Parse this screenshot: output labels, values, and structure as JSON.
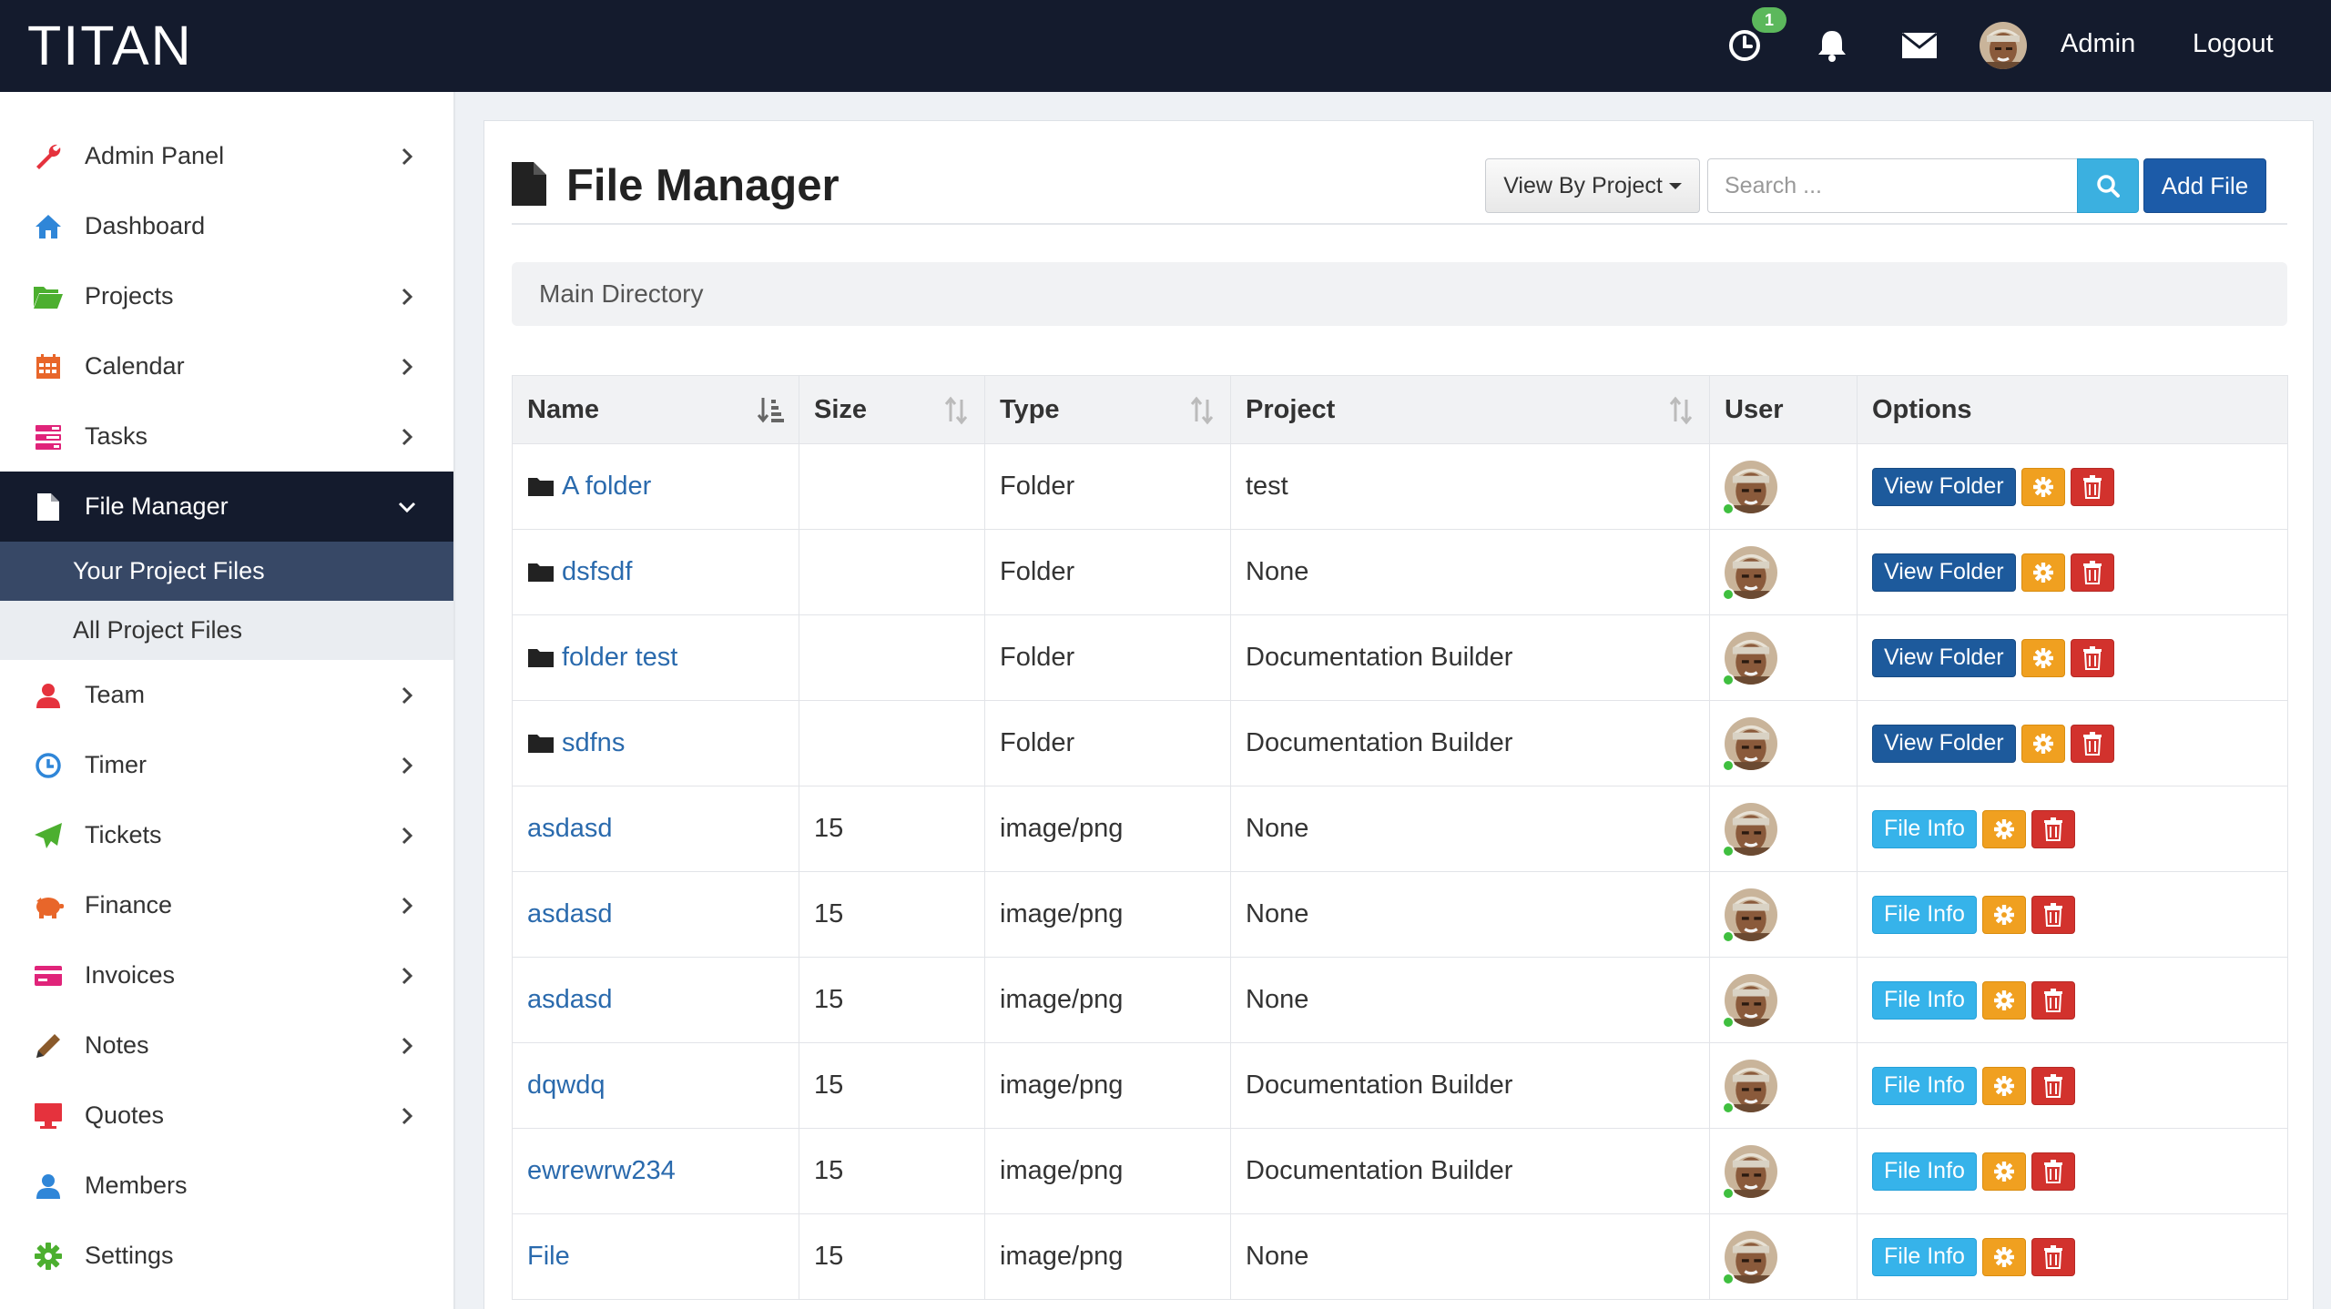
{
  "app": {
    "brand": "TITAN"
  },
  "topbar": {
    "timer_badge": "1",
    "user_name": "Admin",
    "logout_label": "Logout",
    "icons": [
      "clock-icon",
      "bell-icon",
      "envelope-icon",
      "avatar"
    ]
  },
  "sidebar": {
    "items": [
      {
        "label": "Admin Panel",
        "icon": "wrench-icon",
        "color": "#e5323d",
        "has_chevron": true
      },
      {
        "label": "Dashboard",
        "icon": "home-icon",
        "color": "#2f86d8",
        "has_chevron": false
      },
      {
        "label": "Projects",
        "icon": "folder-open-icon",
        "color": "#4caf2f",
        "has_chevron": true
      },
      {
        "label": "Calendar",
        "icon": "calendar-icon",
        "color": "#e8662a",
        "has_chevron": true
      },
      {
        "label": "Tasks",
        "icon": "tasks-icon",
        "color": "#e0247a",
        "has_chevron": true
      },
      {
        "label": "File Manager",
        "icon": "file-icon",
        "color": "#ffffff",
        "has_chevron": true,
        "active": true
      },
      {
        "label": "Team",
        "icon": "user-icon",
        "color": "#e5323d",
        "has_chevron": true
      },
      {
        "label": "Timer",
        "icon": "clock-icon",
        "color": "#2f86d8",
        "has_chevron": true
      },
      {
        "label": "Tickets",
        "icon": "send-icon",
        "color": "#4caf2f",
        "has_chevron": true
      },
      {
        "label": "Finance",
        "icon": "piggy-bank-icon",
        "color": "#e8662a",
        "has_chevron": true
      },
      {
        "label": "Invoices",
        "icon": "credit-card-icon",
        "color": "#e0247a",
        "has_chevron": true
      },
      {
        "label": "Notes",
        "icon": "pencil-icon",
        "color": "#8a5a2b",
        "has_chevron": true
      },
      {
        "label": "Quotes",
        "icon": "monitor-icon",
        "color": "#e5323d",
        "has_chevron": true
      },
      {
        "label": "Members",
        "icon": "user-icon",
        "color": "#2f86d8",
        "has_chevron": false
      },
      {
        "label": "Settings",
        "icon": "gear-icon",
        "color": "#4caf2f",
        "has_chevron": false
      }
    ],
    "submenu": [
      {
        "label": "Your Project Files",
        "current": true
      },
      {
        "label": "All Project Files",
        "current": false
      }
    ]
  },
  "main": {
    "title": "File Manager",
    "view_by_label": "View By Project",
    "search_placeholder": "Search ...",
    "add_file_label": "Add File",
    "breadcrumb": "Main Directory",
    "table": {
      "headers": [
        "Name",
        "Size",
        "Type",
        "Project",
        "User",
        "Options"
      ],
      "rows": [
        {
          "name": "A folder",
          "kind": "folder",
          "size": "",
          "type": "Folder",
          "project": "test",
          "action": "View Folder"
        },
        {
          "name": "dsfsdf",
          "kind": "folder",
          "size": "",
          "type": "Folder",
          "project": "None",
          "action": "View Folder"
        },
        {
          "name": "folder test",
          "kind": "folder",
          "size": "",
          "type": "Folder",
          "project": "Documentation Builder",
          "action": "View Folder"
        },
        {
          "name": "sdfns",
          "kind": "folder",
          "size": "",
          "type": "Folder",
          "project": "Documentation Builder",
          "action": "View Folder"
        },
        {
          "name": "asdasd",
          "kind": "file",
          "size": "15",
          "type": "image/png",
          "project": "None",
          "action": "File Info"
        },
        {
          "name": "asdasd",
          "kind": "file",
          "size": "15",
          "type": "image/png",
          "project": "None",
          "action": "File Info"
        },
        {
          "name": "asdasd",
          "kind": "file",
          "size": "15",
          "type": "image/png",
          "project": "None",
          "action": "File Info"
        },
        {
          "name": "dqwdq",
          "kind": "file",
          "size": "15",
          "type": "image/png",
          "project": "Documentation Builder",
          "action": "File Info"
        },
        {
          "name": "ewrewrw234",
          "kind": "file",
          "size": "15",
          "type": "image/png",
          "project": "Documentation Builder",
          "action": "File Info"
        },
        {
          "name": "File",
          "kind": "file",
          "size": "15",
          "type": "image/png",
          "project": "None",
          "action": "File Info"
        }
      ]
    }
  },
  "colors": {
    "topbar": "#141b2d",
    "active_nav": "#141b2d",
    "current_sub": "#374866",
    "link": "#2a6aad",
    "view_folder_btn": "#1d5a9c",
    "file_info_btn": "#36b3ea",
    "gear_btn": "#f0a020",
    "delete_btn": "#d2322d",
    "search_btn": "#3bb0e0",
    "add_btn": "#1c5ba8",
    "online": "#3fbf3f"
  }
}
